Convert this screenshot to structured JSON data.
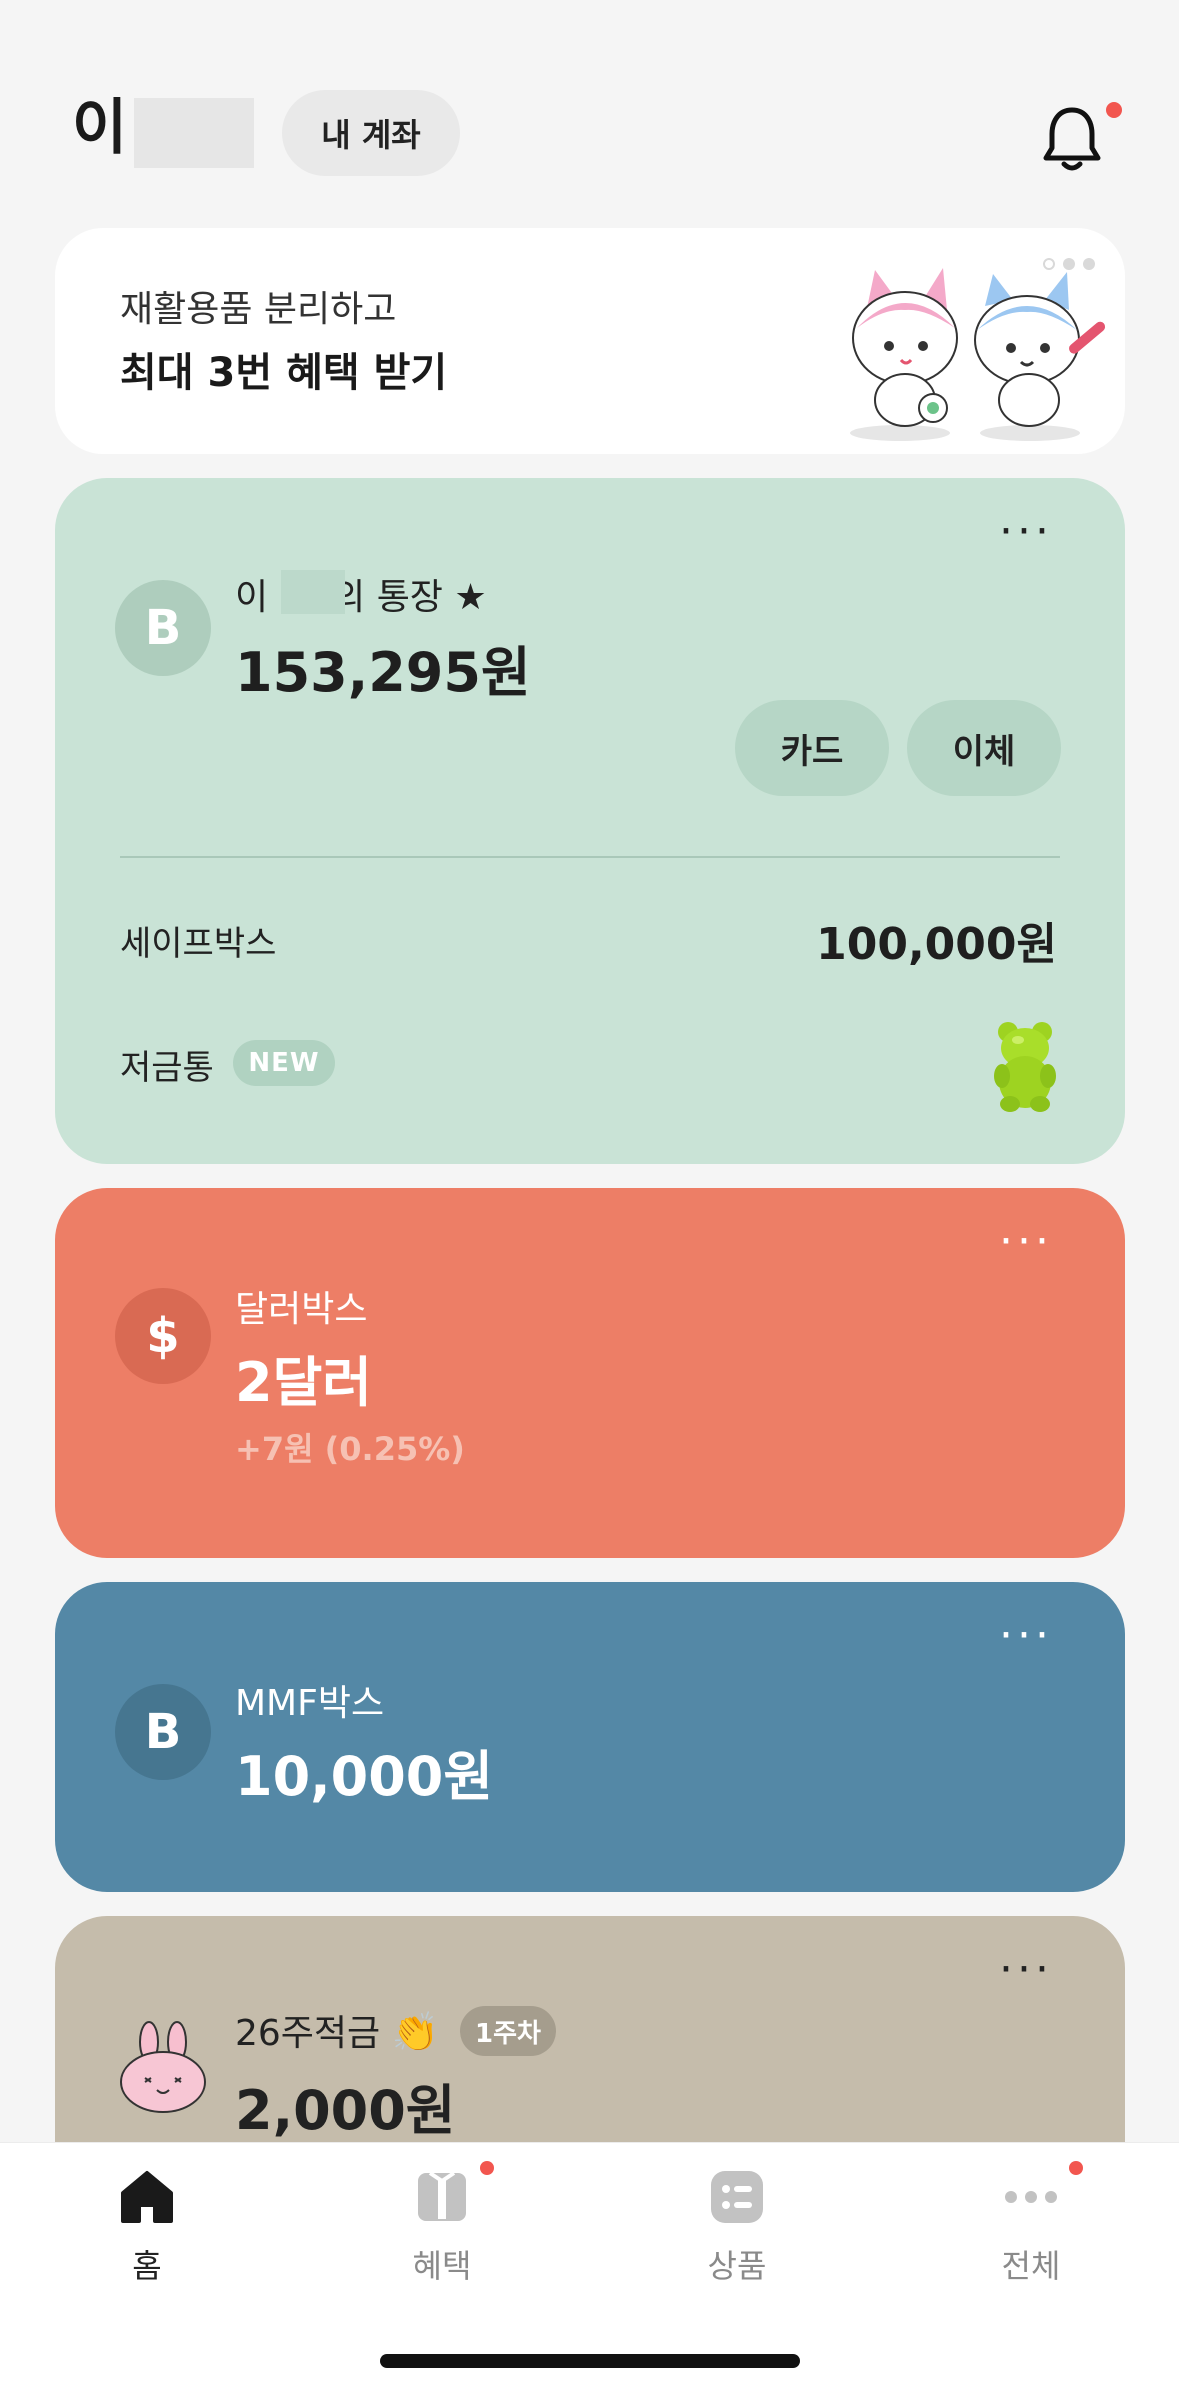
{
  "header": {
    "user_name": "이",
    "my_account_label": "내 계좌"
  },
  "promo": {
    "line1": "재활용품 분리하고",
    "line2": "최대 3번 혜택 받기"
  },
  "main_account": {
    "name_prefix": "이",
    "name_suffix": "의 통장",
    "star": "★",
    "balance": "153,295원",
    "card_button": "카드",
    "transfer_button": "이체",
    "safebox_label": "세이프박스",
    "safebox_amount": "100,000원",
    "piggy_label": "저금통",
    "new_badge": "NEW",
    "icon_letter": "B"
  },
  "dollar_box": {
    "label": "달러박스",
    "amount": "2달러",
    "change": "+7원 (0.25%)",
    "icon_symbol": "$"
  },
  "mmf_box": {
    "label": "MMF박스",
    "amount": "10,000원",
    "icon_letter": "B"
  },
  "savings": {
    "label": "26주적금",
    "clap": "👏",
    "week_badge": "1주차",
    "amount": "2,000원"
  },
  "more_label": "···",
  "nav": {
    "home": "홈",
    "benefits": "혜택",
    "products": "상품",
    "all": "전체"
  },
  "colors": {
    "main_card": "#c9e3d6",
    "dollar_card": "#ed7e66",
    "mmf_card": "#5488a6",
    "savings_card": "#c5bcab",
    "notification_dot": "#f2564f"
  }
}
